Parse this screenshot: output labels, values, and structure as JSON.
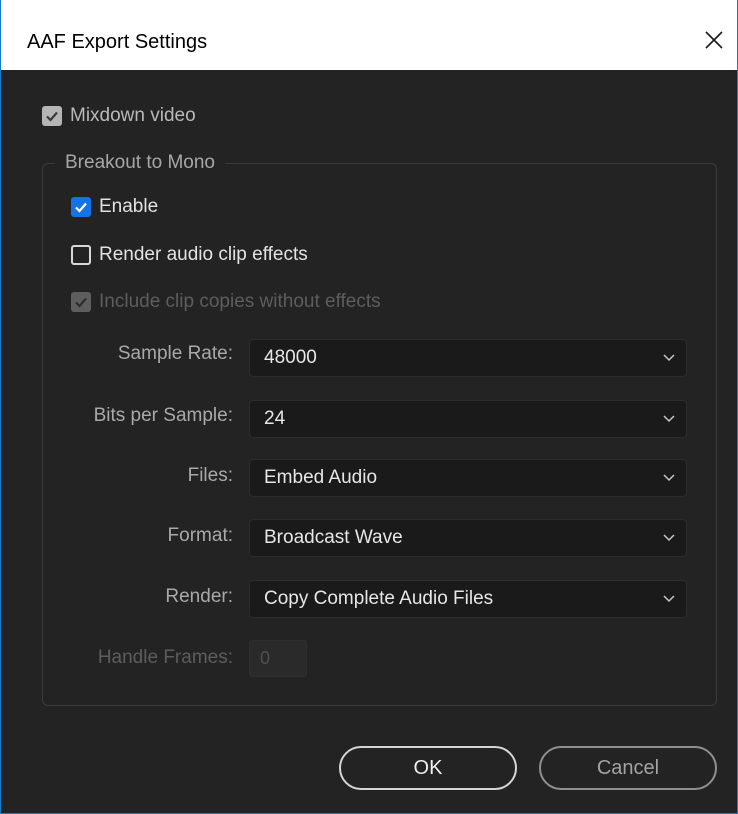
{
  "window": {
    "title": "AAF Export Settings"
  },
  "mixdown_video": {
    "label": "Mixdown video",
    "checked": true,
    "enabled": false
  },
  "breakout": {
    "legend": "Breakout to Mono",
    "enable": {
      "label": "Enable",
      "checked": true
    },
    "render_clip_effects": {
      "label": "Render audio clip effects",
      "checked": false
    },
    "include_copies": {
      "label": "Include clip copies without effects",
      "checked": true,
      "enabled": false
    }
  },
  "fields": {
    "sample_rate": {
      "label": "Sample Rate:",
      "value": "48000"
    },
    "bits_per_sample": {
      "label": "Bits per Sample:",
      "value": "24"
    },
    "files": {
      "label": "Files:",
      "value": "Embed Audio"
    },
    "format": {
      "label": "Format:",
      "value": "Broadcast Wave"
    },
    "render": {
      "label": "Render:",
      "value": "Copy Complete Audio Files"
    },
    "handle_frames": {
      "label": "Handle Frames:",
      "value": "0",
      "enabled": false
    }
  },
  "buttons": {
    "ok": "OK",
    "cancel": "Cancel"
  },
  "colors": {
    "accent": "#1473e6",
    "window_border": "#1c7acd",
    "panel_bg": "#232323"
  },
  "icons": {
    "close": "close-icon",
    "checkmark": "checkmark-icon",
    "chevron": "chevron-down-icon"
  }
}
